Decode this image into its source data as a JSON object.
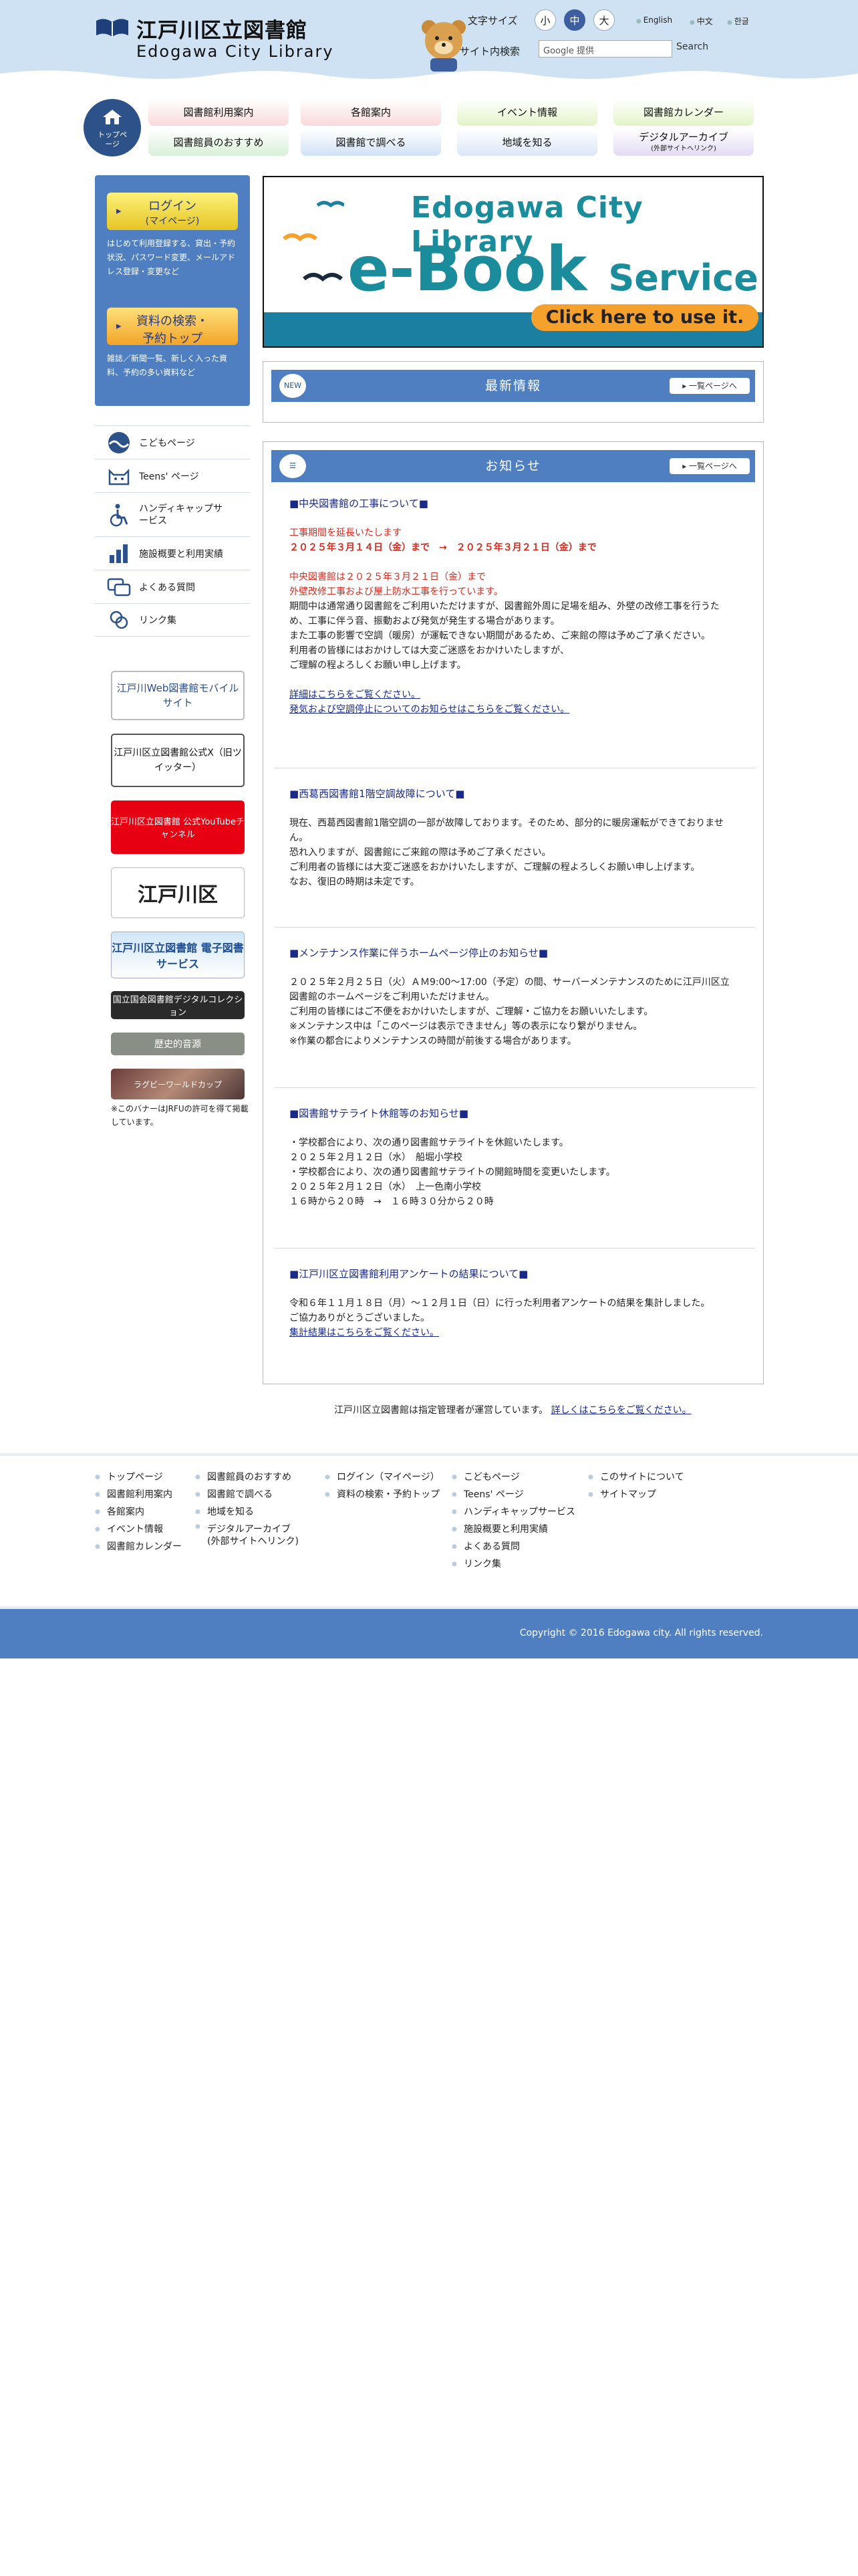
{
  "header": {
    "title": "江戸川区立図書館",
    "subtitle": "Edogawa City Library",
    "font_size_label": "文字サイズ",
    "font_sizes": [
      "小",
      "中",
      "大"
    ],
    "languages": [
      "English",
      "中文",
      "한글"
    ],
    "search_label": "サイト内検索",
    "search_placeholder": "Google 提供",
    "search_button": "Search"
  },
  "nav": {
    "top": "トップページ",
    "items": [
      "図書館利用案内",
      "図書館員のおすすめ",
      "各館案内",
      "図書館で調べる",
      "イベント情報",
      "地域を知る",
      "図書館カレンダー",
      "デジタルアーカイブ"
    ],
    "archive_note": "(外部サイトへリンク)"
  },
  "sidebar": {
    "login_label": "ログイン",
    "login_sub": "(マイページ)",
    "login_desc": "はじめて利用登録する、貸出・予約状況、パスワード変更、メールアドレス登録・変更など",
    "search_label": "資料の検索・",
    "search_sub": "予約トップ",
    "search_desc": "雑誌／新聞一覧、新しく入った資料、予約の多い資料など",
    "menu": [
      "こどもページ",
      "Teens' ページ",
      "ハンディキャップサービス",
      "施設概要と利用実績",
      "よくある質問",
      "リンク集"
    ],
    "banners": {
      "mobile": "江戸川Web図書館モバイルサイト",
      "x": "江戸川区立図書館公式X（旧ツイッター）",
      "youtube": "江戸川区立図書館 公式YouTubeチャンネル",
      "ward": "江戸川区",
      "ebook": "江戸川区立図書館 電子図書サービス",
      "digital": "国立国会図書館デジタルコレクション",
      "history": "歴史的音源",
      "jrfu": "ラグビーワールドカップ"
    },
    "banner_note": "※このバナーはJRFUの許可を得て掲載しています。"
  },
  "ebook": {
    "title": "Edogawa City Library",
    "main": "e-Book",
    "service": "Service",
    "cta": "Click here to use it."
  },
  "news": {
    "badge": "NEW",
    "title": "最新情報",
    "more": "一覧ページへ"
  },
  "notice": {
    "title": "お知らせ",
    "more": "一覧ページへ"
  },
  "articles": [
    {
      "title": "■中央図書館の工事について■",
      "red1": "工事期間を延長いたします",
      "red2": "２０２５年３月１４日（金）まで　→　２０２５年３月２１日（金）まで",
      "red3": "中央図書館は２０２５年３月２１日（金）まで",
      "red4": "外壁改修工事および屋上防水工事を行っています。",
      "body1": "期間中は通常通り図書館をご利用いただけますが、図書館外周に足場を組み、外壁の改修工事を行うため、工事に伴う音、振動および発気が発生する場合があります。",
      "body2": "また工事の影響で空調（暖房）が運転できない期間があるため、ご来館の際は予めご了承ください。",
      "body3": "利用者の皆様にはおかけしては大変ご迷惑をおかけいたしますが、",
      "body4": "ご理解の程よろしくお願い申し上げます。",
      "link1": "詳細はこちらをご覧ください。",
      "link2": "発気および空調停止についてのお知らせはこちらをご覧ください。"
    },
    {
      "title": "■西葛西図書館1階空調故障について■",
      "body1": "現在、西葛西図書館1階空調の一部が故障しております。そのため、部分的に暖房運転ができておりません。",
      "body2": "恐れ入りますが、図書館にご来館の際は予めご了承ください。",
      "body3": "ご利用者の皆様には大変ご迷惑をおかけいたしますが、ご理解の程よろしくお願い申し上げます。",
      "body4": "なお、復旧の時期は未定です。"
    },
    {
      "title": "■メンテナンス作業に伴うホームページ停止のお知らせ■",
      "body1": "２０２５年２月２５日（火）ＡＭ9:00～17:00（予定）の間、サーバーメンテナンスのために江戸川区立図書館のホームページをご利用いただけません。",
      "body2": "ご利用の皆様にはご不便をおかけいたしますが、ご理解・ご協力をお願いいたします。",
      "body3": "※メンテナンス中は「このページは表示できません」等の表示になり繋がりません。",
      "body4": "※作業の都合によりメンテナンスの時間が前後する場合があります。"
    },
    {
      "title": "■図書館サテライト休館等のお知らせ■",
      "body1": "・学校都合により、次の通り図書館サテライトを休館いたします。",
      "body2": "２０２５年２月１２日（水）　船堀小学校",
      "body3": "・学校都合により、次の通り図書館サテライトの開館時間を変更いたします。",
      "body4": "２０２５年２月１２日（水）　上一色南小学校",
      "body5": "１６時から２０時　→　１６時３０分から２０時"
    },
    {
      "title": "■江戸川区立図書館利用アンケートの結果について■",
      "body1": "令和６年１１月１８日（月）～１２月１日（日）に行った利用者アンケートの結果を集計しました。",
      "body2": "ご協力ありがとうございました。",
      "link1": "集計結果はこちらをご覧ください。"
    }
  ],
  "management": {
    "text": "江戸川区立図書館は指定管理者が運営しています。",
    "link": "詳しくはこちらをご覧ください。"
  },
  "footer": {
    "col1": [
      "トップページ",
      "図書館利用案内",
      "各館案内",
      "イベント情報",
      "図書館カレンダー"
    ],
    "col2": [
      "図書館員のおすすめ",
      "図書館で調べる",
      "地域を知る",
      "デジタルアーカイブ",
      "(外部サイトへリンク)"
    ],
    "col3": [
      "ログイン（マイページ）",
      "資料の検索・予約トップ"
    ],
    "col4": [
      "こどもページ",
      "Teens' ページ",
      "ハンディキャップサービス",
      "施設概要と利用実績",
      "よくある質問",
      "リンク集"
    ],
    "col5": [
      "このサイトについて",
      "サイトマップ"
    ],
    "copyright": "Copyright © 2016 Edogawa city. All rights reserved."
  },
  "colors": {
    "header_bg": "#cfe2f3",
    "accent": "#4f7fc0",
    "dark_blue": "#2d5189",
    "red": "#d42a20"
  }
}
